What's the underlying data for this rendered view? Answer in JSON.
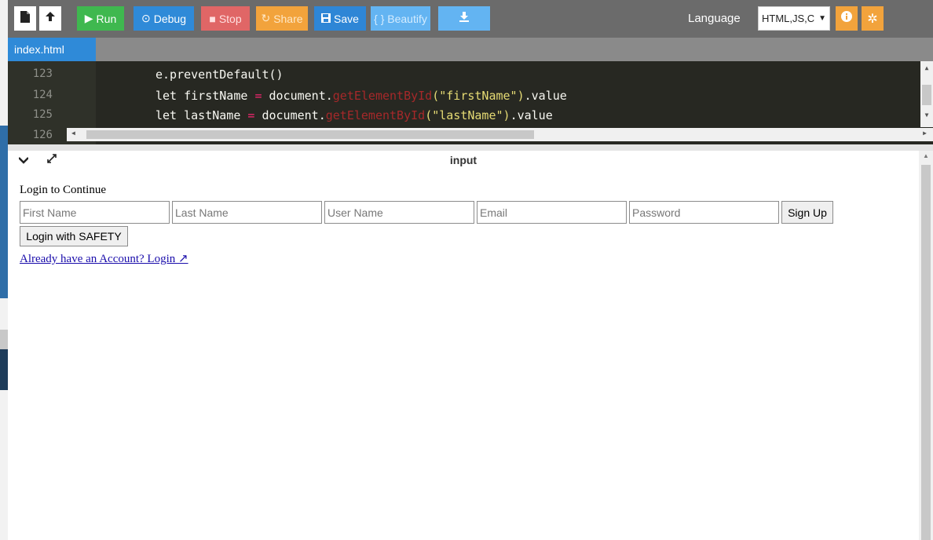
{
  "toolbar": {
    "new_icon": "file-icon",
    "upload_icon": "cloud-upload-icon",
    "run_label": "Run",
    "debug_label": "Debug",
    "stop_label": "Stop",
    "share_label": "Share",
    "save_label": "Save",
    "beautify_label": "{ } Beautify",
    "download_icon": "download-icon",
    "language_label": "Language",
    "language_value": "HTML,JS,C",
    "info_icon": "info-icon",
    "settings_icon": "gear-icon"
  },
  "tabs": {
    "active_file": "index.html"
  },
  "editor": {
    "lines": [
      {
        "num": "123",
        "pre": "e.preventDefault()",
        "fn": "",
        "str": "",
        "post": ""
      },
      {
        "num": "124",
        "pre": "let firstName ",
        "eq": "=",
        "mid": " document.",
        "fn": "getElementById",
        "str": "(\"firstName\")",
        "post": ".value"
      },
      {
        "num": "125",
        "pre": "let lastName ",
        "eq": "=",
        "mid": " document.",
        "fn": "getElementById",
        "str": "(\"lastName\")",
        "post": ".value"
      },
      {
        "num": "126",
        "pre": "",
        "eq": "",
        "mid": "",
        "fn": "",
        "str": "",
        "post": ""
      }
    ]
  },
  "output": {
    "panel_title": "input",
    "heading": "Login to Continue",
    "fields": {
      "first_name_placeholder": "First Name",
      "last_name_placeholder": "Last Name",
      "user_name_placeholder": "User Name",
      "email_placeholder": "Email",
      "password_placeholder": "Password"
    },
    "signup_label": "Sign Up",
    "safety_label": "Login with SAFETY",
    "login_link": "Already have an Account? Login ↗"
  },
  "colors": {
    "toolbar_bg": "#6b6b6b",
    "run_green": "#3fb84f",
    "accent_blue": "#2f8ad8",
    "stop_red": "#e06666",
    "share_orange": "#f2a33c",
    "editor_bg": "#272822"
  }
}
